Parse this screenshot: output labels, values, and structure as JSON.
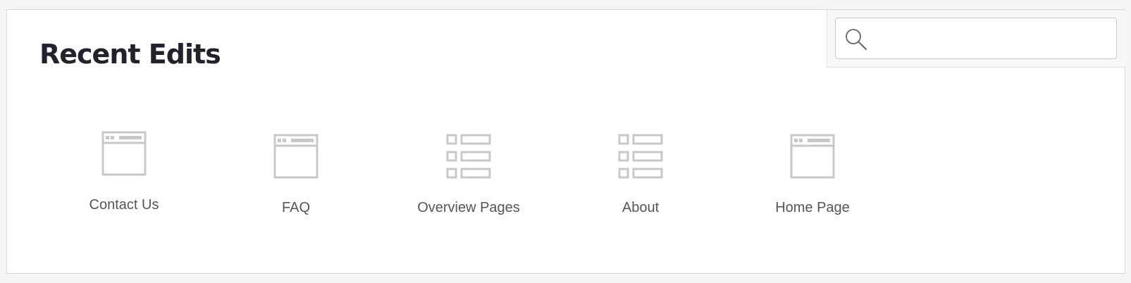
{
  "header": {
    "title": "Recent Edits"
  },
  "search": {
    "value": "",
    "placeholder": "",
    "icon": "search-icon"
  },
  "recent_items": [
    {
      "label": "Contact Us",
      "icon": "page-icon"
    },
    {
      "label": "FAQ",
      "icon": "page-icon"
    },
    {
      "label": "Overview Pages",
      "icon": "list-icon"
    },
    {
      "label": "About",
      "icon": "list-icon"
    },
    {
      "label": "Home Page",
      "icon": "page-icon"
    }
  ],
  "colors": {
    "icon_stroke": "#c8c8c8",
    "title": "#22222c",
    "label": "#555555",
    "panel_border": "#d6d6d6"
  }
}
